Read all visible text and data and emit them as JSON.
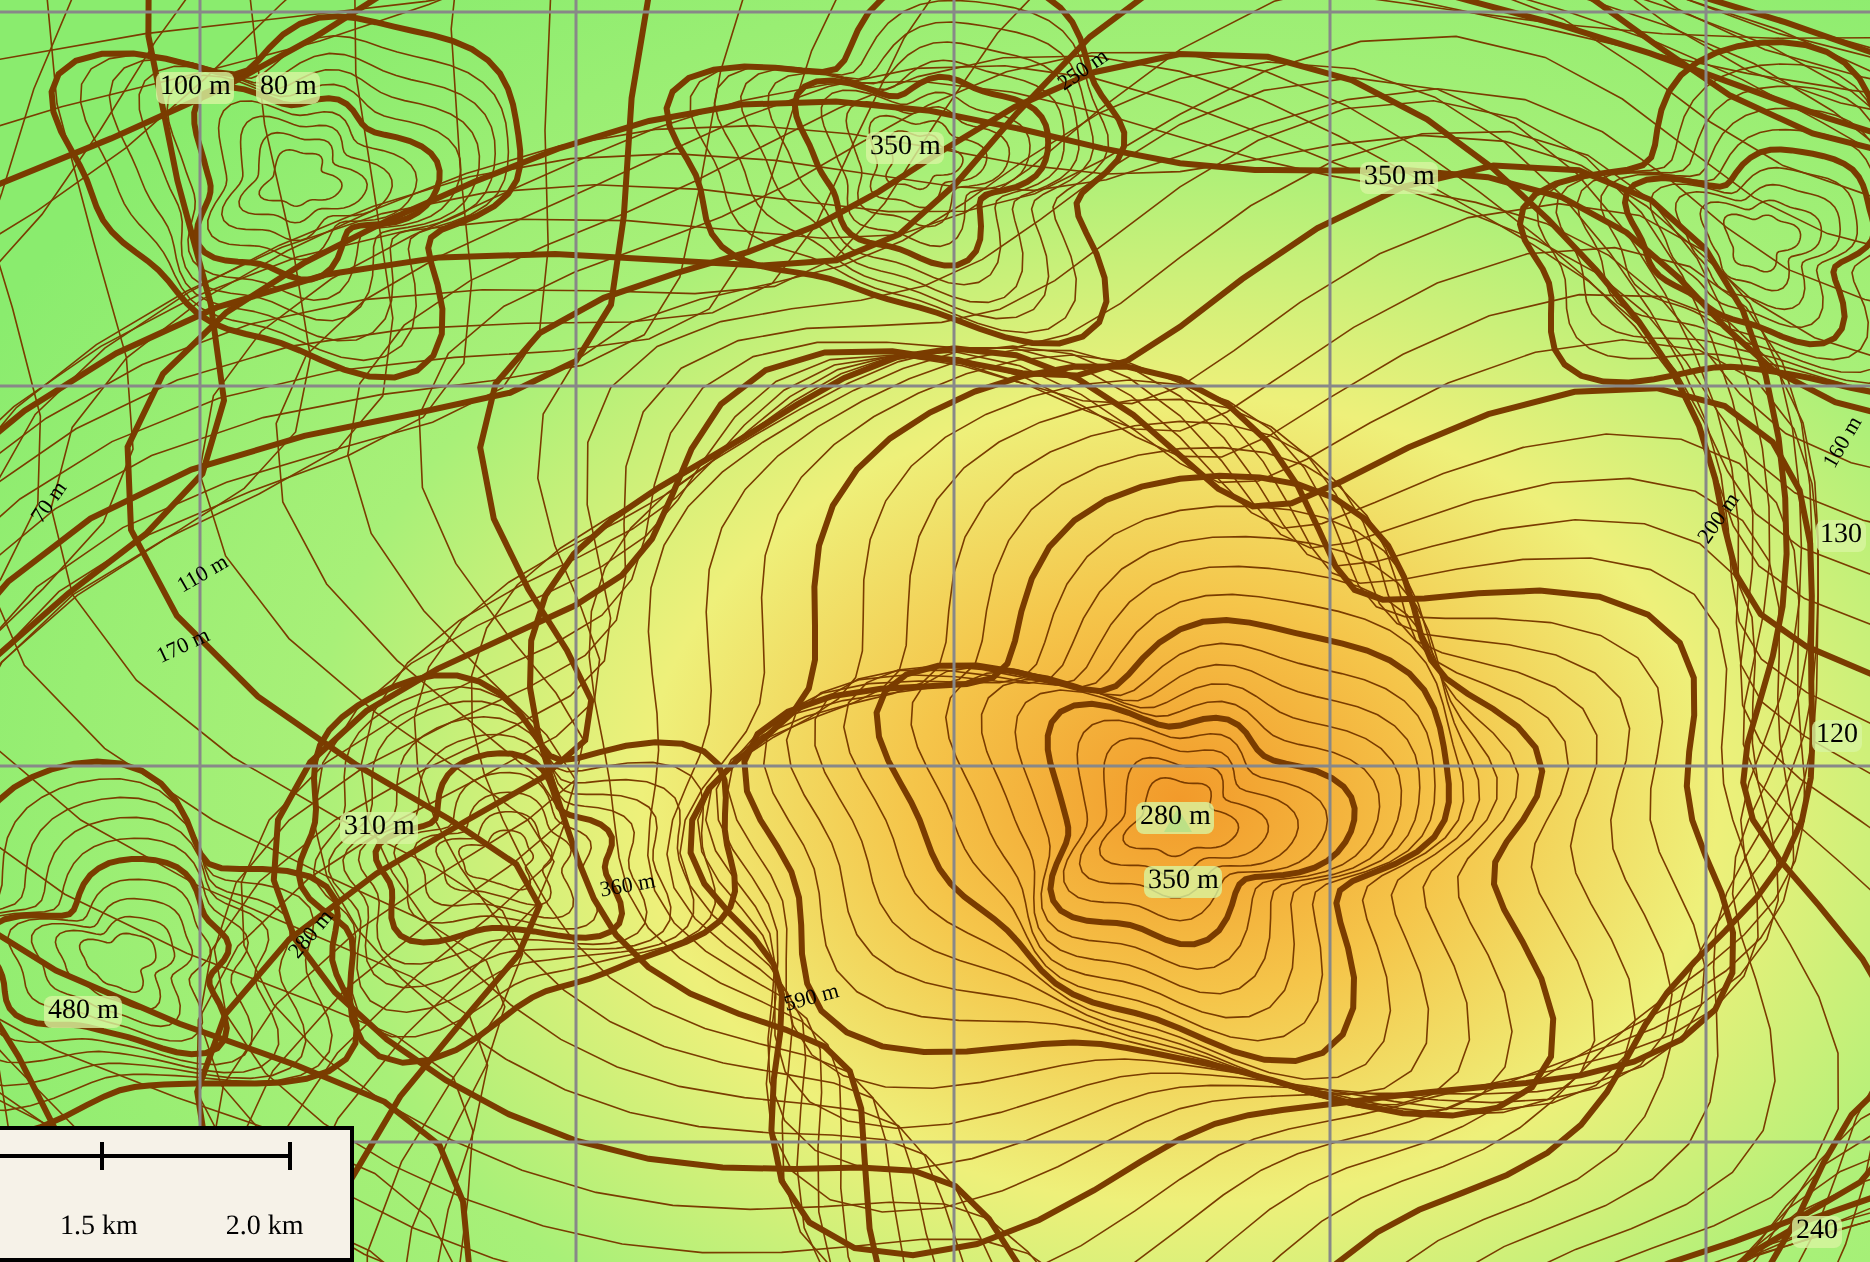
{
  "map": {
    "spot_heights": [
      "100 m",
      "80 m",
      "350 m",
      "350 m",
      "310 m",
      "480 m",
      "280 m",
      "350 m",
      "130",
      "120",
      "240"
    ],
    "contour_labels": [
      "110 m",
      "70 m",
      "170 m",
      "280 m",
      "360 m",
      "590 m",
      "250 m",
      "200 m",
      "160 m"
    ]
  },
  "scale_bar": {
    "labels": [
      "1.5 km",
      "2.0 km"
    ]
  }
}
